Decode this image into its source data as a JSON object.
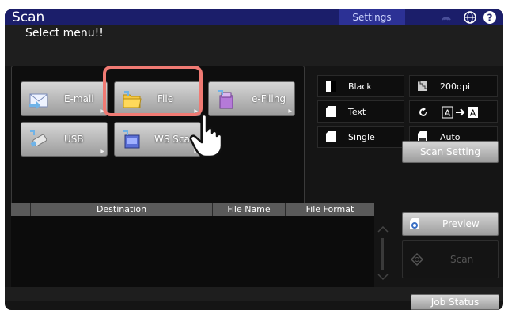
{
  "header": {
    "title": "Scan",
    "settings_label": "Settings"
  },
  "prompt": "Select menu!!",
  "menu": {
    "email": "E-mail",
    "file": "File",
    "efiling": "e-Filing",
    "usb": "USB",
    "wsscan": "WS Scan"
  },
  "settings_panel": {
    "color": "Black",
    "resolution": "200dpi",
    "mode": "Text",
    "single": "Single",
    "auto": "Auto",
    "scan_setting": "Scan Setting"
  },
  "table": {
    "columns": [
      "Destination",
      "File Name",
      "File Format"
    ],
    "rows": []
  },
  "actions": {
    "preview": "Preview",
    "scan": "Scan",
    "job_status": "Job Status"
  },
  "colors": {
    "header": "#1b1e6a",
    "highlight": "#f07a73",
    "panel": "#151515"
  },
  "icons": [
    "signal-icon",
    "globe-icon",
    "help-icon",
    "mail-icon",
    "folder-icon",
    "efiling-icon",
    "usb-icon",
    "wsscan-icon",
    "pointer-hand-icon"
  ]
}
